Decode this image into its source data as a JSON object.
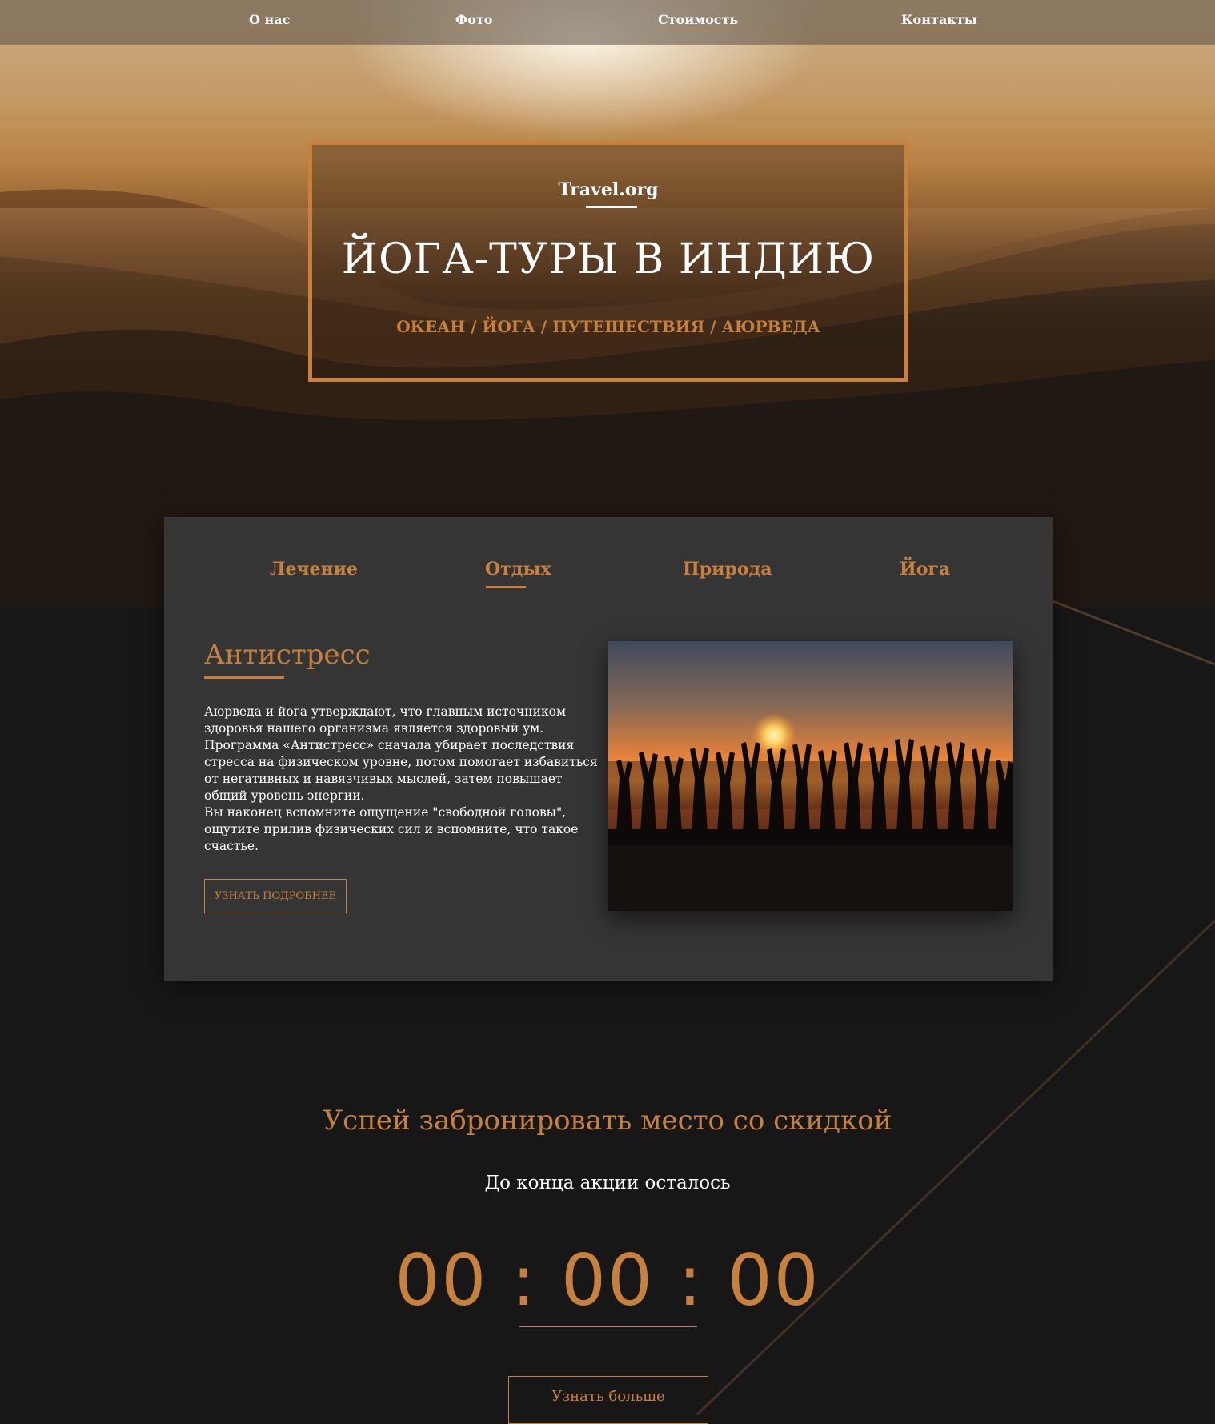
{
  "nav": {
    "items": [
      {
        "label": "О нас"
      },
      {
        "label": "Фото"
      },
      {
        "label": "Стоимость"
      },
      {
        "label": "Контакты"
      }
    ]
  },
  "hero": {
    "brand": "Travel.org",
    "title": "ЙОГА-ТУРЫ В ИНДИЮ",
    "subtitle": "ОКЕАН / ЙОГА / ПУТЕШЕСТВИЯ / АЮРВЕДА"
  },
  "tabs": {
    "items": [
      {
        "label": "Лечение",
        "active": false
      },
      {
        "label": "Отдых",
        "active": true
      },
      {
        "label": "Природа",
        "active": false
      },
      {
        "label": "Йога",
        "active": false
      }
    ]
  },
  "content": {
    "title": "Антистресс",
    "paragraphs": [
      "Аюрведа и йога утверждают, что главным источником здоровья нашего организма является здоровый ум. Программа «Антистресс» сначала убирает последствия стресса на физическом уровне, потом помогает избавиться от негативных и навязчивых мыслей, затем повышает общий уровень энергии.",
      "Вы наконец вспомните ощущение \"свободной головы\", ощутите прилив физических сил и вспомните, что такое счастье."
    ],
    "button_label": "УЗНАТЬ ПОДРОБНЕЕ"
  },
  "booking": {
    "title": "Успей забронировать место со скидкой",
    "subtitle": "До конца акции осталось",
    "timer": {
      "hours": "00",
      "minutes": "00",
      "seconds": "00",
      "separator": ":"
    },
    "button_label": "Узнать больше"
  },
  "colors": {
    "accent": "#c8813d",
    "card_bg": "#363535",
    "page_bg": "#181717"
  }
}
